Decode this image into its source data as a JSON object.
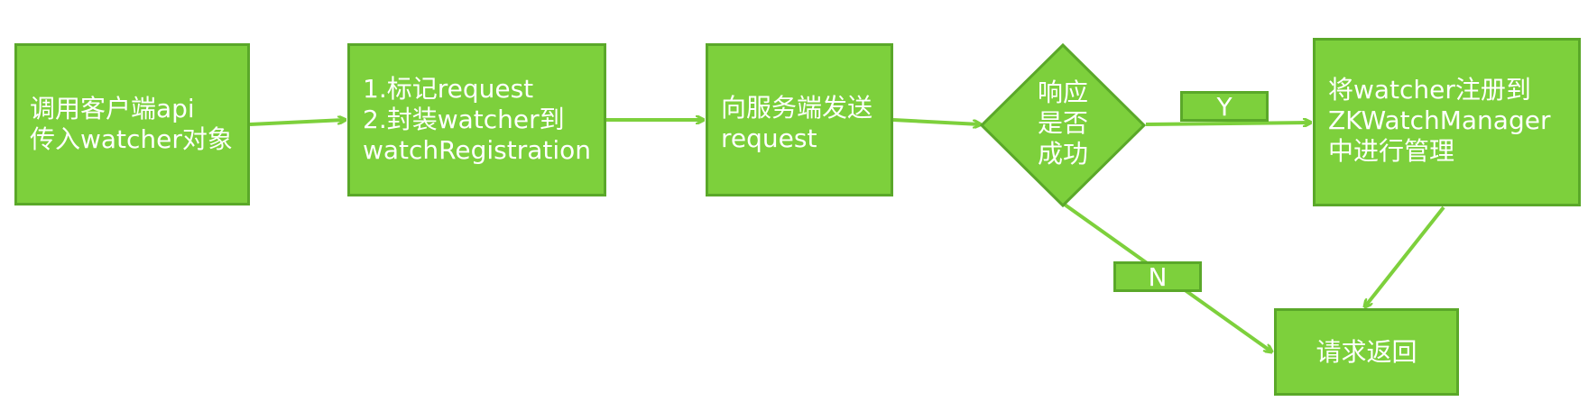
{
  "diagram": {
    "nodes": {
      "call_api": {
        "text": "调用客户端api\n传入watcher对象"
      },
      "mark_request": {
        "text": "1.标记request\n2.封装watcher到\nwatchRegistration"
      },
      "send_request": {
        "text": "向服务端发送\nrequest"
      },
      "response_ok": {
        "text": "响应\n是否\n成功"
      },
      "register_watcher": {
        "text": "将watcher注册到\nZKWatchManager\n中进行管理"
      },
      "return_request": {
        "text": "请求返回"
      }
    },
    "edge_labels": {
      "yes": "Y",
      "no": "N"
    },
    "colors": {
      "fill": "#7dd03c",
      "border": "#5aa829",
      "arrow": "#7dd03c",
      "text": "#ffffff"
    }
  }
}
